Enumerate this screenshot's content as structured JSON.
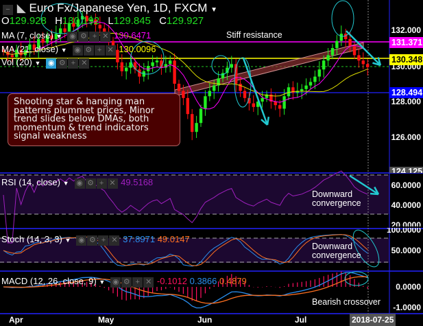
{
  "header": {
    "title": "Euro Fx/Japanese Yen, 1D, FXCM",
    "ohlc": {
      "o_label": "O",
      "o": "129.928",
      "h_label": "H",
      "h": "130.192",
      "l_label": "L",
      "l": "129.845",
      "c_label": "C",
      "c": "129.927"
    }
  },
  "indicators": {
    "ma7": {
      "label": "MA (7, close)",
      "value": "130.6471",
      "color": "#ff00ff"
    },
    "ma21": {
      "label": "MA (21, close)",
      "value": "130.0096",
      "color": "#ffff00"
    },
    "vol": {
      "label": "Vol (20)"
    },
    "rsi": {
      "label": "RSI (14, close)",
      "value": "49.5168",
      "color": "#a020c0"
    },
    "stoch": {
      "label": "Stoch (14, 3, 3)",
      "k": "37.8971",
      "d": "49.0147"
    },
    "macd": {
      "label": "MACD (12, 26, close, 9)",
      "hist": "-0.1012",
      "macd": "0.3866",
      "signal": "0.4879"
    }
  },
  "icons": [
    "eye-icon",
    "gear-icon",
    "plus-icon",
    "close-icon"
  ],
  "annotations": {
    "box": "Shooting star & hanging man patterns plummet prices, Minor trend slides below DMAs,  both momentum & trend indicators signal weakness",
    "resistance": "Stiff resistance",
    "rsi_note": [
      "Downward",
      "convergence"
    ],
    "stoch_note": [
      "Downward",
      "convergence"
    ],
    "macd_note": "Bearish crossover"
  },
  "price_axis": {
    "ticks": [
      "132.000",
      "130.000",
      "128.000",
      "126.000"
    ],
    "tags": [
      {
        "value": "131.371",
        "bg": "#ff00ff",
        "fg": "#ffffff"
      },
      {
        "value": "130.348",
        "bg": "#ffff00",
        "fg": "#000000"
      },
      {
        "value": "128.494",
        "bg": "#0000ff",
        "fg": "#ffffff"
      },
      {
        "value": "124.125",
        "bg": "#555555",
        "fg": "#ffffff"
      }
    ]
  },
  "rsi_axis": [
    "60.0000",
    "40.0000",
    "20.0000"
  ],
  "stoch_axis": [
    "100.0000",
    "50.0000"
  ],
  "macd_axis": [
    "0.0000",
    "-1.0000"
  ],
  "time_axis": {
    "labels": [
      "Apr",
      "May",
      "Jun",
      "Jul"
    ],
    "cursor": "2018-07-25"
  },
  "chart_data": {
    "type": "candlestick",
    "symbol": "EUR/JPY",
    "interval": "1D",
    "ylim": [
      124.125,
      132.9
    ],
    "closes": [
      130.8,
      130.6,
      130.5,
      130.9,
      130.6,
      130.9,
      131.2,
      130.9,
      131.5,
      131.3,
      131.7,
      131.5,
      131.8,
      132.1,
      131.9,
      132.4,
      132.2,
      132.6,
      132.8,
      132.5,
      132.6,
      132.3,
      132.1,
      131.9,
      131.4,
      130.9,
      130.2,
      129.7,
      129.9,
      130.2,
      129.8,
      129.4,
      129.7,
      130.0,
      130.2,
      130.3,
      129.9,
      130.1,
      130.3,
      129.0,
      128.6,
      128.2,
      127.3,
      126.3,
      126.8,
      127.6,
      128.3,
      128.6,
      128.9,
      129.3,
      129.6,
      129.9,
      130.1,
      129.0,
      128.6,
      128.2,
      127.9,
      127.7,
      128.0,
      128.2,
      128.4,
      128.0,
      127.8,
      127.6,
      128.3,
      128.8,
      128.5,
      128.6,
      128.7,
      128.9,
      129.1,
      129.4,
      129.8,
      130.3,
      130.6,
      131.0,
      131.4,
      131.8,
      131.5,
      131.1,
      130.6,
      130.3,
      130.1,
      129.927
    ],
    "levels": {
      "resistance": 131.371,
      "yellow": 130.348,
      "support": 128.494,
      "last": 129.927
    },
    "colors": {
      "up": "#22ee22",
      "down": "#ff1111",
      "ma7": "#ff00ff",
      "ma21": "#dddd00",
      "stoch_k": "#2a8ff0",
      "stoch_d": "#ff7020",
      "macd": "#2a8ff0",
      "signal": "#ff7020",
      "hist": "#ff1060"
    }
  }
}
